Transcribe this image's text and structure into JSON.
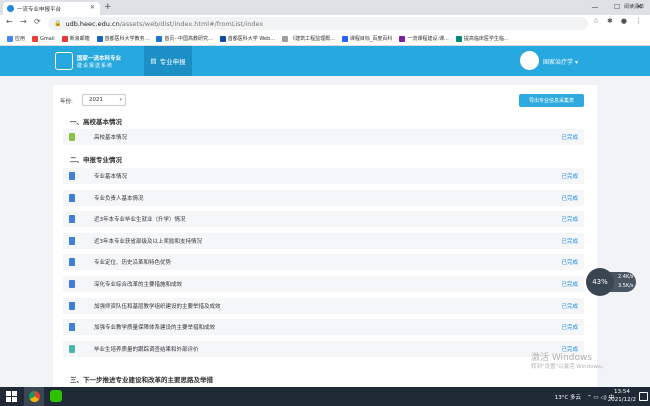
{
  "browser": {
    "tab_title": "一流专业申报平台",
    "url_host": "udb.heec.edu.cn",
    "url_path": "/assets/web/dist/index.html#/fromList/index",
    "bookmarks": [
      {
        "label": "应用",
        "color": "#4285f4"
      },
      {
        "label": "Gmail",
        "color": "#ea4335"
      },
      {
        "label": "新浪邮箱",
        "color": "#e53935"
      },
      {
        "label": "首都医科大学教务...",
        "color": "#1565c0"
      },
      {
        "label": "首页--中国高教研究...",
        "color": "#1976d2"
      },
      {
        "label": "首都医科大学 Web...",
        "color": "#0d47a1"
      },
      {
        "label": "《建筑工程监理概...",
        "color": "#9e9e9e"
      },
      {
        "label": "课程目标_百度百科",
        "color": "#2962ff"
      },
      {
        "label": "一流课程建设:课...",
        "color": "#7b1fa2"
      },
      {
        "label": "提高临床医学生临...",
        "color": "#00897b"
      }
    ],
    "reading_list": "阅读清单"
  },
  "header": {
    "logo_line1": "国家一流本科专业",
    "logo_line2": "建设报送系统",
    "nav_tab": "专业申报",
    "user_name": "国家治疗学"
  },
  "toolbar": {
    "year_label": "年份:",
    "year_value": "2021",
    "export_label": "导出专业信息采集表"
  },
  "sections": [
    {
      "title": "一、高校基本情况",
      "rows": [
        {
          "label": "高校基本情况",
          "status": "已完成",
          "icon_color": "#8bc34a"
        }
      ]
    },
    {
      "title": "二、申报专业情况",
      "rows": [
        {
          "label": "专业基本情况",
          "status": "已完成",
          "icon_color": "#3f7fd6"
        },
        {
          "label": "专业负责人基本情况",
          "status": "已完成",
          "icon_color": "#3f7fd6"
        },
        {
          "label": "近3年本专业毕业生就业（升学）情况",
          "status": "已完成",
          "icon_color": "#3f7fd6"
        },
        {
          "label": "近3年本专业获省部级及以上奖励和支持情况",
          "status": "已完成",
          "icon_color": "#3f7fd6"
        },
        {
          "label": "专业定位、历史沿革和特色优势",
          "status": "已完成",
          "icon_color": "#3f7fd6"
        },
        {
          "label": "深化专业综合改革的主要措施和成效",
          "status": "已完成",
          "icon_color": "#3f7fd6"
        },
        {
          "label": "加强师资队伍和基层教学组织建设的主要举措及成效",
          "status": "已完成",
          "icon_color": "#3f7fd6"
        },
        {
          "label": "加强专业教学质量保障体系建设的主要举措和成效",
          "status": "已完成",
          "icon_color": "#3f7fd6"
        },
        {
          "label": "毕业生培养质量的跟踪调查结果和外部评价",
          "status": "已完成",
          "icon_color": "#4db6ac"
        }
      ]
    },
    {
      "title": "三、下一步推进专业建设和改革的主要思路及举措",
      "rows": []
    }
  ],
  "watermark": {
    "line1": "激活 Windows",
    "line2": "转到\"设置\"以激活 Windows。"
  },
  "speed": {
    "percent": "43%",
    "up": "2.4K/s",
    "down": "3.5K/s"
  },
  "taskbar": {
    "weather": "13°C 多云",
    "time": "13:54",
    "date": "2021/12/2"
  }
}
